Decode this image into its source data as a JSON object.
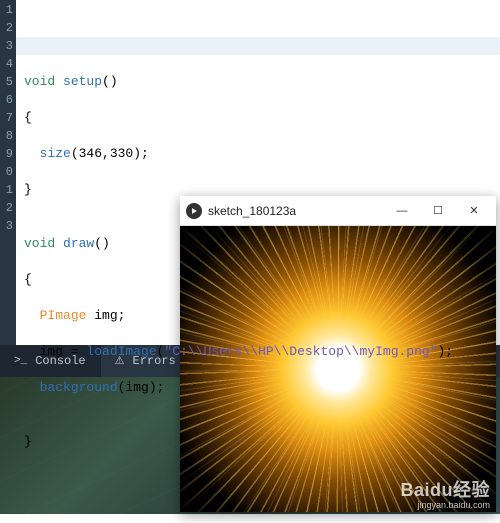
{
  "gutter": [
    "1",
    "2",
    "3",
    "4",
    "5",
    "6",
    "7",
    "8",
    "9",
    "0",
    "1",
    "2",
    "3"
  ],
  "code": {
    "l1": {
      "kw": "void",
      "fn": "setup",
      "rest": "()"
    },
    "l2": "{",
    "l3": {
      "fn": "size",
      "args": "(346,330);"
    },
    "l4": "}",
    "l5": "",
    "l6": {
      "kw": "void",
      "fn": "draw",
      "rest": "()"
    },
    "l7": "{",
    "l8": {
      "type": "PImage",
      "rest": " img;"
    },
    "l9": {
      "a": "img = ",
      "fn": "loadImage",
      "p": "(",
      "str": "\"C:\\\\Users\\\\HP\\\\Desktop\\\\myImg.png\"",
      "e": ");"
    },
    "l10": {
      "fn": "background",
      "args": "(img);"
    },
    "l11": "",
    "l12": "}"
  },
  "tabs": {
    "console": "Console",
    "errors": "Errors"
  },
  "sketch": {
    "title": "sketch_180123a",
    "min": "—",
    "max": "☐",
    "close": "✕"
  },
  "watermark": {
    "main": "Baidu经验",
    "sub": "jingyan.baidu.com"
  }
}
